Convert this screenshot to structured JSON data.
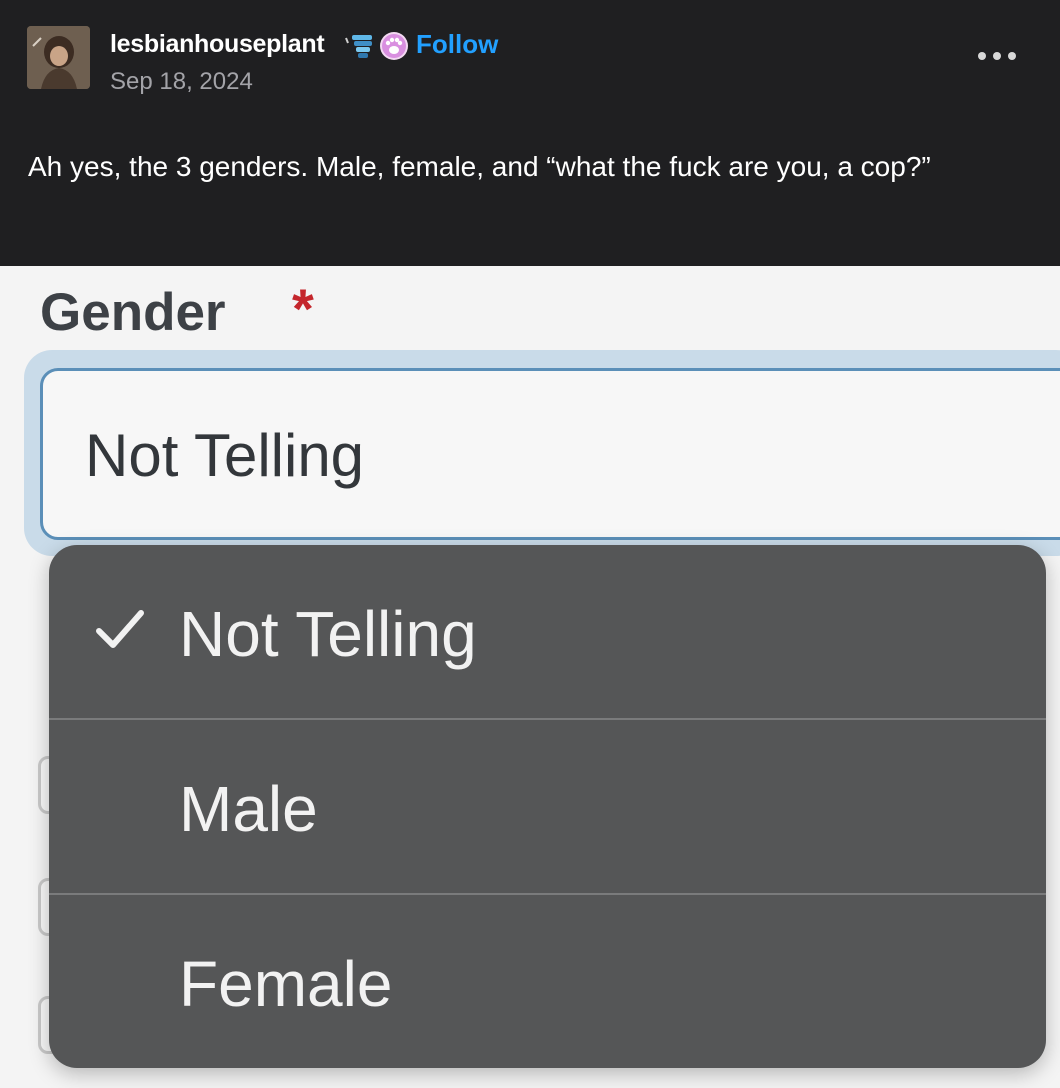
{
  "post": {
    "username": "lesbianhouseplant",
    "follow_label": "Follow",
    "date": "Sep 18, 2024",
    "text": "Ah yes, the 3 genders. Male, female, and “what the fuck are you, a cop?”",
    "icons": [
      "avatar",
      "badge-stack-icon",
      "paw-badge-icon",
      "more-options-icon"
    ],
    "colors": {
      "background": "#1f1f21",
      "follow": "#22a0ff",
      "date": "#a3a3a8"
    }
  },
  "form": {
    "field_label": "Gender",
    "required_marker": "*",
    "selected_value": "Not Telling",
    "options": [
      {
        "label": "Not Telling",
        "checked": true
      },
      {
        "label": "Male",
        "checked": false
      },
      {
        "label": "Female",
        "checked": false
      }
    ],
    "colors": {
      "required": "#c4262c",
      "focus_border": "#5b8fb8",
      "menu_background": "#555657"
    }
  }
}
